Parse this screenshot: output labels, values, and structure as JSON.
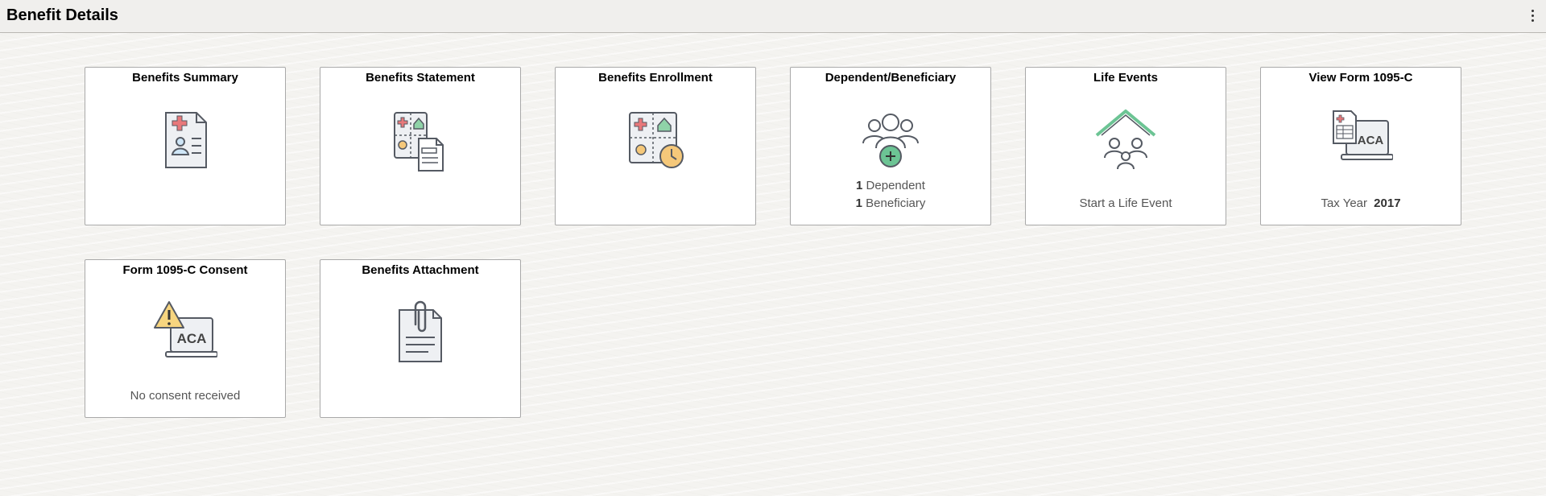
{
  "header": {
    "title": "Benefit Details",
    "menu_icon": "vertical-ellipsis-icon"
  },
  "tiles": [
    {
      "title": "Benefits Summary",
      "icon": "benefits-summary-icon"
    },
    {
      "title": "Benefits Statement",
      "icon": "benefits-statement-icon"
    },
    {
      "title": "Benefits Enrollment",
      "icon": "benefits-enrollment-icon"
    },
    {
      "title": "Dependent/Beneficiary",
      "icon": "dependent-beneficiary-icon",
      "dependents_count": "1",
      "dependents_label": "Dependent",
      "beneficiaries_count": "1",
      "beneficiaries_label": "Beneficiary"
    },
    {
      "title": "Life Events",
      "icon": "life-events-icon",
      "info": "Start a Life Event"
    },
    {
      "title": "View Form 1095-C",
      "icon": "form-1095c-icon",
      "info_label": "Tax Year",
      "info_value": "2017",
      "icon_text": "ACA"
    },
    {
      "title": "Form 1095-C Consent",
      "icon": "consent-warning-icon",
      "info": "No consent received",
      "icon_text": "ACA"
    },
    {
      "title": "Benefits Attachment",
      "icon": "attachment-icon"
    }
  ],
  "colors": {
    "cross_red": "#e8787a",
    "house_green": "#8fd3a8",
    "bag_yellow": "#f5c87a",
    "add_green": "#6cc494",
    "warning_yellow": "#f7d57f",
    "icon_stroke": "#555a63",
    "doc_fill": "#eef0f3"
  }
}
